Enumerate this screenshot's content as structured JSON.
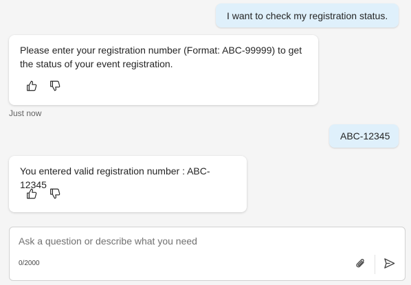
{
  "messages": {
    "user_1": "I want to check my registration status.",
    "bot_1": "Please enter your registration number (Format: ABC-99999) to get the status of your event registration.",
    "bot_1_timestamp": "Just now",
    "user_2": "ABC-12345",
    "bot_2": "You entered valid registration number : ABC-12345"
  },
  "composer": {
    "placeholder": "Ask a question or describe what you need",
    "char_count": "0/2000"
  },
  "icons": {
    "like": "thumbs-up-icon",
    "dislike": "thumbs-down-icon",
    "attach": "paperclip-icon",
    "send": "send-icon"
  },
  "colors": {
    "user_bubble": "#dff0fb",
    "bot_card": "#ffffff",
    "background": "#f5f5f5"
  }
}
